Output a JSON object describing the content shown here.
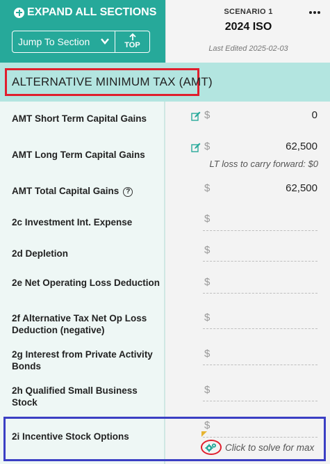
{
  "header": {
    "expand_label": "EXPAND ALL SECTIONS",
    "jump_label": "Jump To Section",
    "top_label": "TOP",
    "scenario_label": "SCENARIO 1",
    "scenario_name": "2024 ISO",
    "last_edited": "Last Edited 2025-02-03"
  },
  "section": {
    "title": "ALTERNATIVE MINIMUM TAX (AMT)"
  },
  "currency_symbol": "$",
  "rows": [
    {
      "label": "AMT Short Term Capital Gains",
      "value": "0"
    },
    {
      "label": "AMT Long Term Capital Gains",
      "value": "62,500",
      "note": "LT loss to carry forward: $0"
    },
    {
      "label": "AMT Total Capital Gains",
      "value": "62,500"
    },
    {
      "label": "2c Investment Int. Expense",
      "value": ""
    },
    {
      "label": "2d Depletion",
      "value": ""
    },
    {
      "label": "2e Net Operating Loss Deduction",
      "value": ""
    },
    {
      "label": "2f Alternative Tax Net Op Loss Deduction (negative)",
      "value": ""
    },
    {
      "label": "2g Interest from Private Activity Bonds",
      "value": ""
    },
    {
      "label": "2h Qualified Small Business Stock",
      "value": ""
    },
    {
      "label": "2i Incentive Stock Options",
      "value": "",
      "action": "Click to solve for max"
    }
  ],
  "colors": {
    "header_teal": "#26a99a",
    "section_bg": "#b3e5e0",
    "highlight_red": "#e01f2d",
    "highlight_blue": "#3b3fc4"
  }
}
